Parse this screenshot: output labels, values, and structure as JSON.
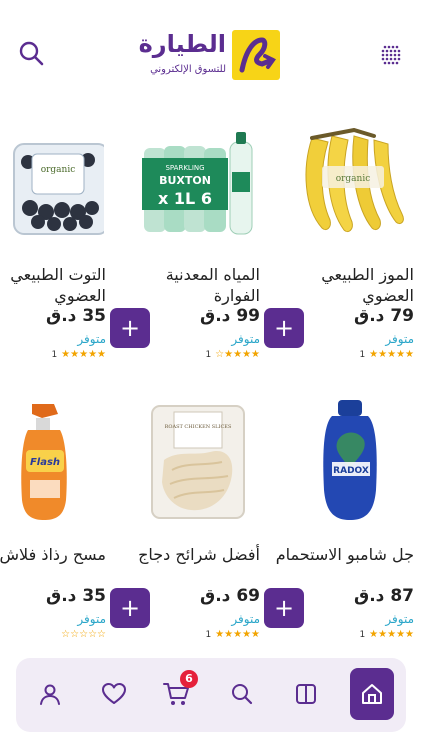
{
  "header": {
    "logo_title": "الطيارة",
    "logo_subtitle": "للتسوق الإلكتروني",
    "search_icon": "search-icon",
    "menu_icon": "dots-grid-icon"
  },
  "colors": {
    "brand_purple": "#5b2d90",
    "brand_yellow": "#f7d417",
    "stock_blue": "#2aa6c9",
    "star_orange": "#f2a400",
    "badge_red": "#e5203a"
  },
  "products": [
    {
      "name": "الموز الطبيعي العضوي",
      "price": "79 د.ق",
      "stock": "متوفر",
      "stars": "★★★★★",
      "rating_count": "1"
    },
    {
      "name": "المياه المعدنية الفوارة",
      "price": "99 د.ق",
      "stock": "متوفر",
      "stars": "★★★★☆",
      "rating_count": "1"
    },
    {
      "name": "التوت الطبيعي العضوي",
      "price": "35 د.ق",
      "stock": "متوفر",
      "stars": "★★★★★",
      "rating_count": "1"
    },
    {
      "name": "جل شامبو الاستحمام",
      "price": "87 د.ق",
      "stock": "متوفر",
      "stars": "★★★★★",
      "rating_count": "1"
    },
    {
      "name": "أفضل شرائح دجاج",
      "price": "69 د.ق",
      "stock": "متوفر",
      "stars": "★★★★★",
      "rating_count": "1"
    },
    {
      "name": "مسح رذاذ فلاش",
      "price": "35 د.ق",
      "stock": "متوفر",
      "stars": "☆☆☆☆☆",
      "rating_count": ""
    }
  ],
  "image_labels": {
    "water_brand": "SPARKLING",
    "water_name": "BUXTON",
    "water_size": "6 x 1L",
    "berries_label": "organic",
    "banana_label": "organic",
    "shampoo_brand": "RADOX",
    "spray_brand": "Flash",
    "chicken_label": "ROAST CHICKEN SLICES"
  },
  "add_label": "+",
  "bottom_nav": {
    "cart_count": "6",
    "items": [
      "profile-icon",
      "heart-icon",
      "cart-icon",
      "search-icon",
      "categories-icon",
      "home-icon"
    ]
  }
}
